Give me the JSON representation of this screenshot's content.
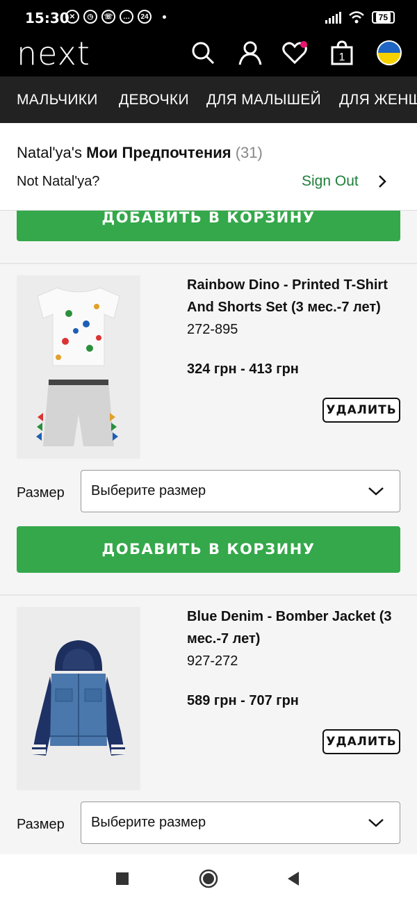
{
  "status": {
    "time": "15:30",
    "notif_badge": "24",
    "battery": "75"
  },
  "header": {
    "logo": "next",
    "bag_count": "1"
  },
  "categories": [
    "МАЛЬЧИКИ",
    "ДЕВОЧКИ",
    "ДЛЯ МАЛЫШЕЙ",
    "ДЛЯ ЖЕНЩ"
  ],
  "preferences": {
    "user": "Natal'ya's",
    "title": "Мои Предпочтения",
    "count": "(31)",
    "not_user": "Not Natal'ya?",
    "sign_out": "Sign Out"
  },
  "add_to_cart": "ДОБАВИТЬ В КОРЗИНУ",
  "size_label": "Размер",
  "size_placeholder": "Выберите размер",
  "remove_label": "УДАЛИТЬ",
  "items": [
    {
      "title_l1": "Rainbow Dino - Printed T-Shirt",
      "title_l2": "And Shorts Set (3 мес.-7 лет)",
      "code": "272-895",
      "price": "324 грн - 413 грн"
    },
    {
      "title_l1": "Blue Denim - Bomber Jacket (3",
      "title_l2": "мес.-7 лет)",
      "code": "927-272",
      "price": "589 грн - 707 грн"
    }
  ],
  "colors": {
    "green": "#34a84a",
    "sign_out": "#1d7f3a",
    "header": "#000000",
    "nav": "#222222"
  }
}
